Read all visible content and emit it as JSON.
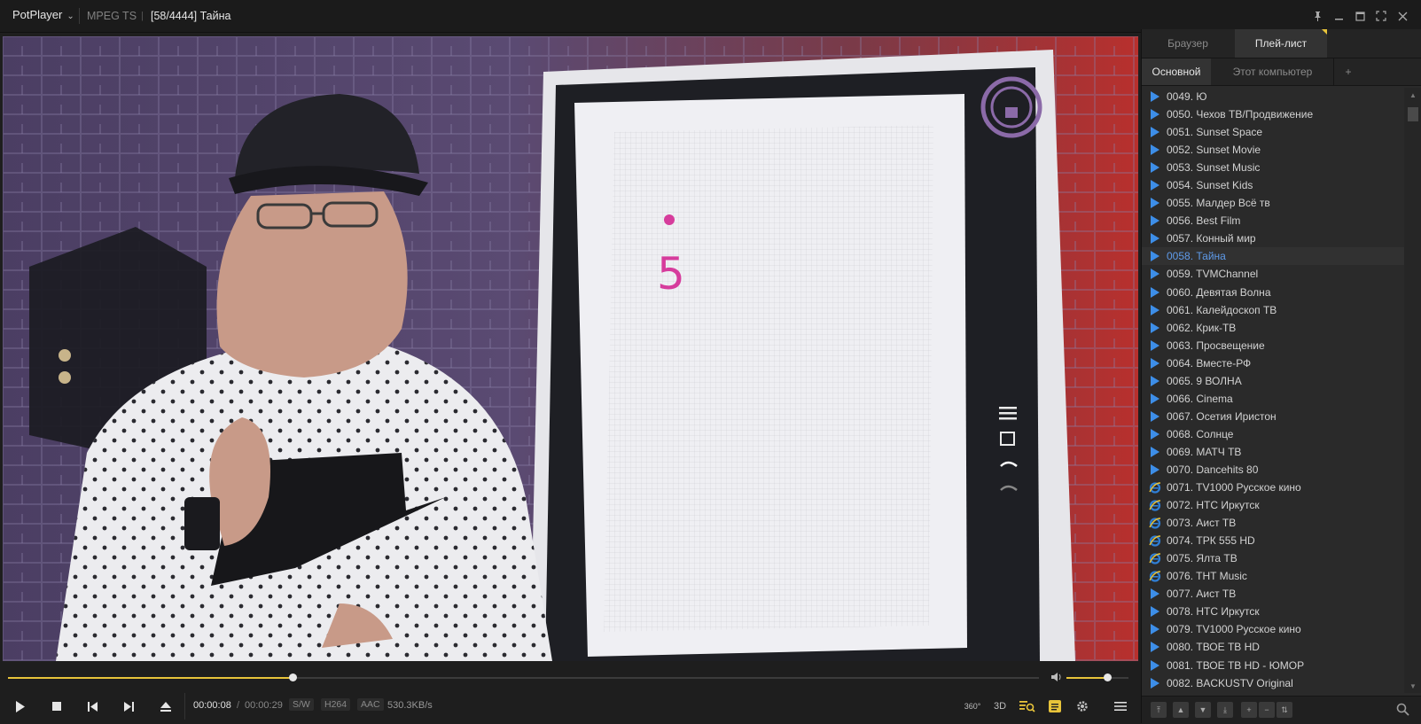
{
  "titlebar": {
    "app_menu": "PotPlayer",
    "format": "MPEG TS",
    "separator": "|",
    "title": "[58/4444] Тайна"
  },
  "controls": {
    "time_current": "00:00:08",
    "time_separator": "/",
    "time_total": "00:00:29",
    "badge_sw": "S/W",
    "badge_video": "H264",
    "badge_audio": "AAC",
    "bitrate": "530.3KB/s",
    "btn_360": "360°",
    "btn_3d": "3D",
    "seek_fraction": 0.276,
    "volume_fraction": 0.65
  },
  "sidebar": {
    "tabs": [
      "Браузер",
      "Плей-лист"
    ],
    "subtabs": [
      "Основной",
      "Этот компьютер",
      "+"
    ],
    "playlist": [
      {
        "label": "0049. Ю",
        "icon": "play"
      },
      {
        "label": "0050. Чехов ТВ/Продвижение",
        "icon": "play"
      },
      {
        "label": "0051. Sunset Space",
        "icon": "play"
      },
      {
        "label": "0052. Sunset Movie",
        "icon": "play"
      },
      {
        "label": "0053. Sunset Music",
        "icon": "play"
      },
      {
        "label": "0054. Sunset Kids",
        "icon": "play"
      },
      {
        "label": "0055.  Малдер Всё тв",
        "icon": "play"
      },
      {
        "label": "0056.  Best Film",
        "icon": "play"
      },
      {
        "label": "0057. Конный мир",
        "icon": "play"
      },
      {
        "label": "0058. Тайна",
        "icon": "play",
        "active": true
      },
      {
        "label": "0059. TVMChannel",
        "icon": "play"
      },
      {
        "label": "0060. Девятая Волна",
        "icon": "play"
      },
      {
        "label": "0061. Калейдоскоп ТВ",
        "icon": "play"
      },
      {
        "label": "0062. Крик-ТВ",
        "icon": "play"
      },
      {
        "label": "0063. Просвещение",
        "icon": "play"
      },
      {
        "label": "0064. Вместе-РФ",
        "icon": "play"
      },
      {
        "label": "0065. 9 ВОЛНА",
        "icon": "play"
      },
      {
        "label": "0066. Cinema",
        "icon": "play"
      },
      {
        "label": "0067. Осетия Иристон",
        "icon": "play"
      },
      {
        "label": "0068. Солнце",
        "icon": "play"
      },
      {
        "label": "0069. МАТЧ ТВ",
        "icon": "play"
      },
      {
        "label": "0070. Dancehits 80",
        "icon": "play"
      },
      {
        "label": "0071. TV1000 Русское кино",
        "icon": "ie"
      },
      {
        "label": "0072. НТС Иркутск",
        "icon": "ie"
      },
      {
        "label": "0073. Аист ТВ",
        "icon": "ie"
      },
      {
        "label": "0074. ТРК 555 HD",
        "icon": "ie"
      },
      {
        "label": "0075. Ялта ТВ",
        "icon": "ie"
      },
      {
        "label": "0076. THT Music",
        "icon": "ie"
      },
      {
        "label": "0077. Аист ТВ",
        "icon": "play"
      },
      {
        "label": "0078. НТС Иркутск",
        "icon": "play"
      },
      {
        "label": "0079. TV1000 Русское кино",
        "icon": "play"
      },
      {
        "label": "0080. ТВОЕ ТВ HD",
        "icon": "play"
      },
      {
        "label": "0081. ТВОЕ ТВ HD - ЮМОР",
        "icon": "play"
      },
      {
        "label": "0082. BACKUSTV Original",
        "icon": "play"
      }
    ]
  },
  "colors": {
    "accent": "#e8c43a",
    "active_text": "#5f9bea",
    "play_icon": "#3d8ee8",
    "tab_active_bg": "#333333"
  },
  "video": {
    "board_digit": "5"
  }
}
